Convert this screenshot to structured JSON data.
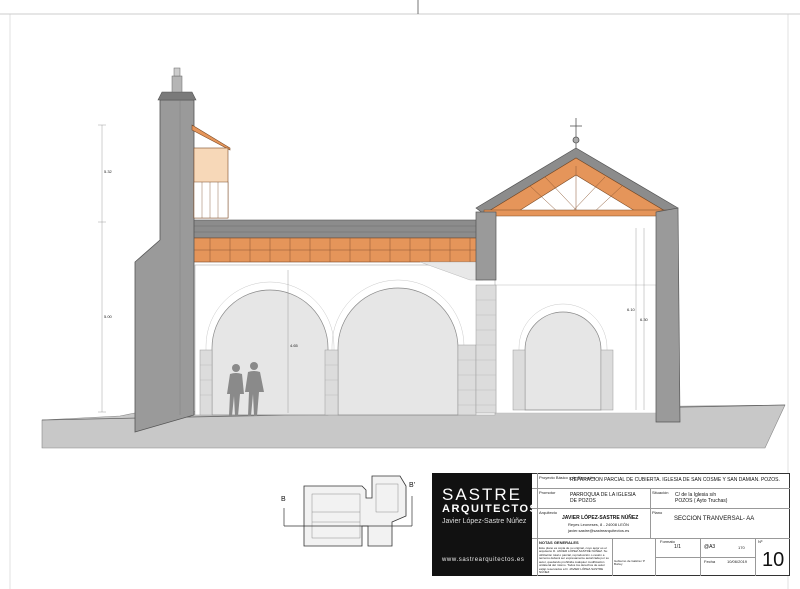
{
  "drawing": {
    "dimensions": [
      "5.32",
      "5.00",
      "4.65",
      "6.10",
      "6.30"
    ]
  },
  "titleblock": {
    "brand": {
      "name": "SASTRE",
      "subtitle": "ARQUITECTOS",
      "architect": "Javier López-Sastre Núñez",
      "website": "www.sastrearquitectos.es"
    },
    "project_type_label": "Proyecto Básico y de Ejecución",
    "project_title": "REPARACION PARCIAL DE CUBIERTA. IGLESIA DE SAN COSME Y SAN DAMIAN. POZOS.",
    "promoter_label": "Promotor",
    "promoter_value": "PARROQUIA DE LA IGLESIA DE POZOS",
    "location_label": "Situación",
    "location_value": "C/ de la Iglesia s/n POZOS ( Ayto Truchas)",
    "architect_label": "Arquitecto",
    "architect_name": "JAVIER LÓPEZ-SASTRE NÚÑEZ",
    "architect_detail1": "Reyes Leoneses, 8 - 24008 LEÓN",
    "architect_detail2": "javier.sastre@sastrearquitectos.es",
    "plan_label": "Plano",
    "plan_title": "SECCION TRANVERSAL- AA",
    "notes_label": "NOTAS GENERALES",
    "notes_text": "Este plano es copia de su original, cuyo autor es el arquitecto D. JAVIER LÓPEZ-SASTRE NÚÑEZ. Su utilización total o parcial, reproducción o cesión a terceros deberá ser expresamente autorizada por su autor, quedando prohibida cualquier modificación unilateral del mismo. Todos los derechos de autor están reservados a D. JAVIER LÓPEZ-SASTRE NÚÑEZ",
    "scale_label": "Formato",
    "scale_value": "1/1",
    "format_value": "@A3",
    "ref_value": "170",
    "date_label": "Fecha",
    "date_value": "10/06/2019",
    "sheet_label": "Nº",
    "sheet_number": "10",
    "misc_line": "Gobierno de Galicia / P Burley"
  },
  "keyplan": {
    "label_left": "B",
    "label_right": "B'"
  }
}
